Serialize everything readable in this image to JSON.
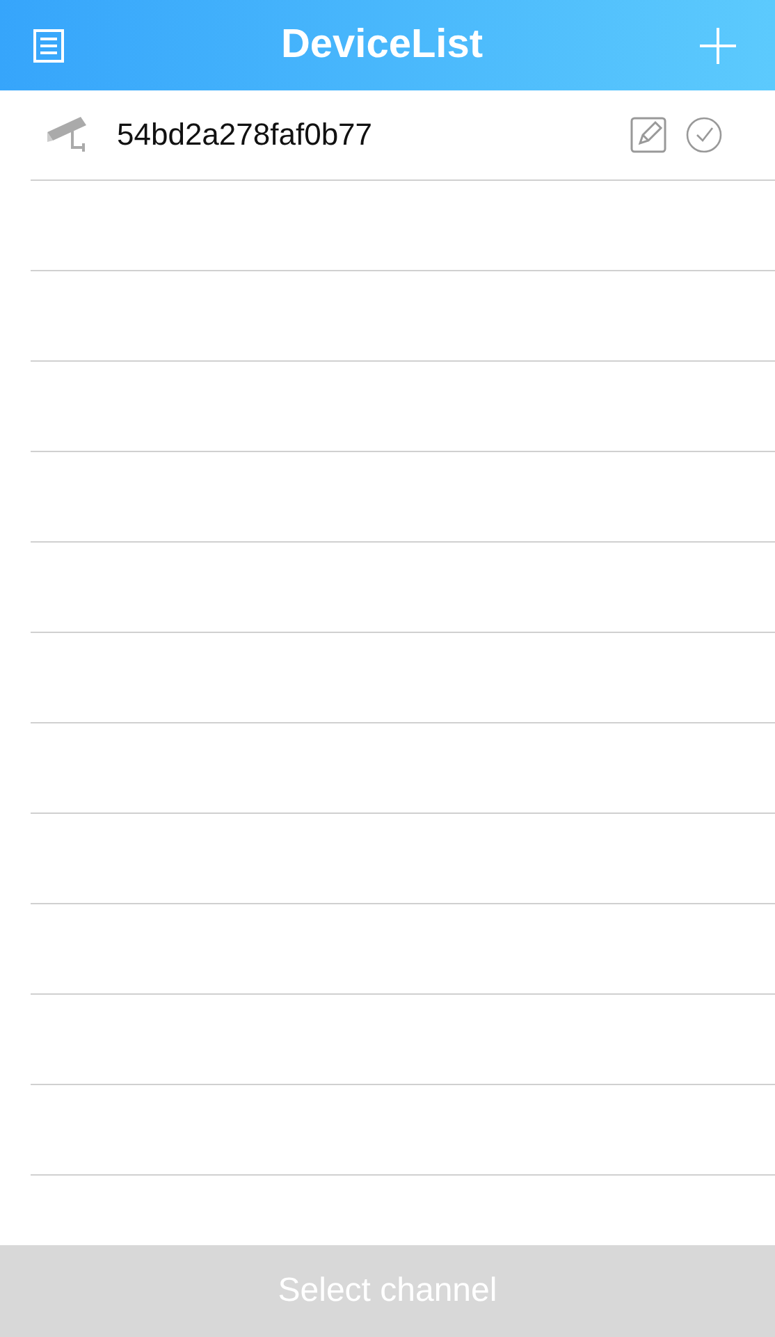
{
  "header": {
    "title": "DeviceList"
  },
  "devices": [
    {
      "name": "54bd2a278faf0b77",
      "selected": false
    }
  ],
  "select_button": {
    "label": "Select channel",
    "disabled": true
  }
}
